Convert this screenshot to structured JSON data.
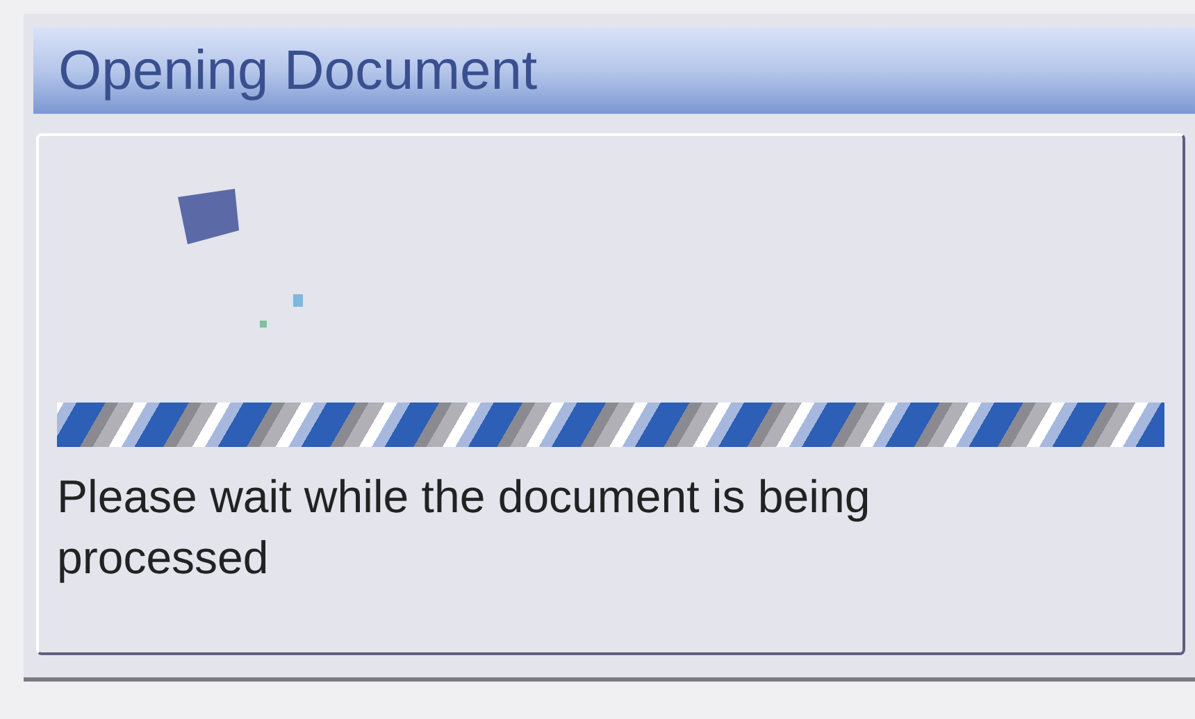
{
  "dialog": {
    "title": "Opening Document",
    "message": "Please wait while the document is being processed"
  }
}
